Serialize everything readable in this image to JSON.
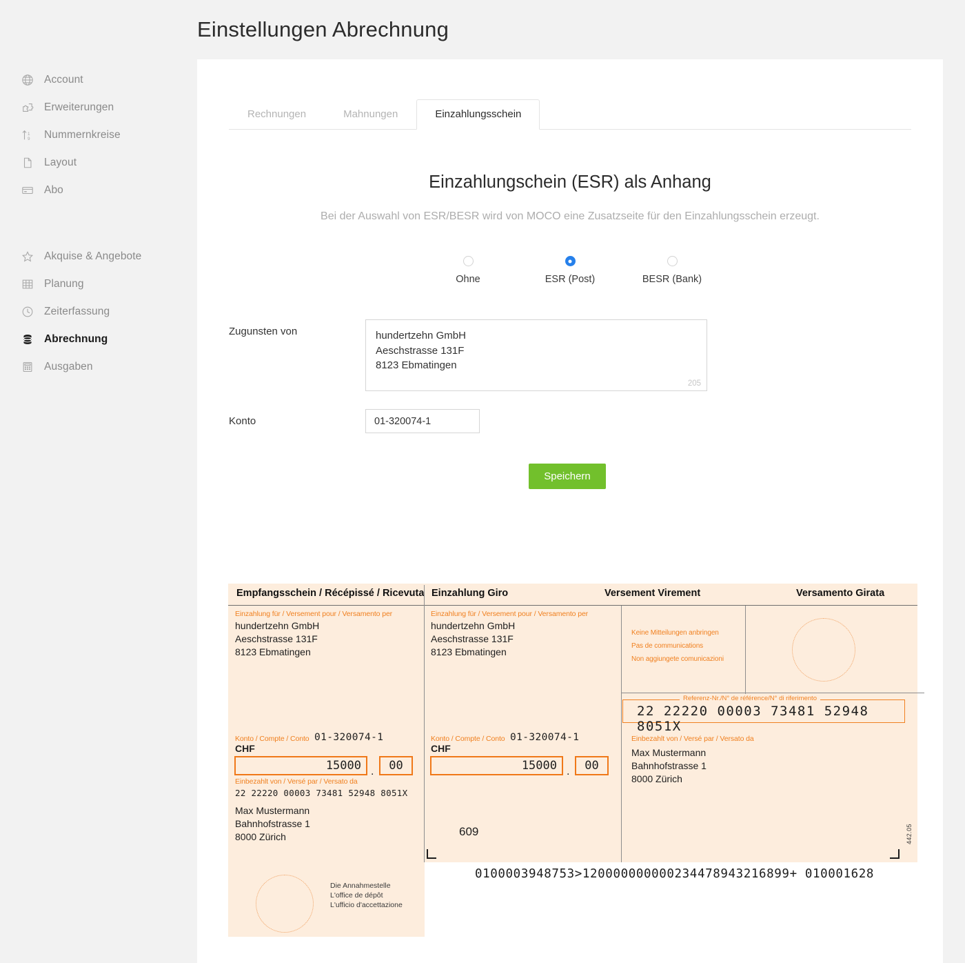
{
  "header": {
    "title": "Einstellungen Abrechnung"
  },
  "sidebar": {
    "group1": [
      {
        "label": "Account",
        "icon": "globe-icon"
      },
      {
        "label": "Erweiterungen",
        "icon": "puzzle-icon"
      },
      {
        "label": "Nummernkreise",
        "icon": "number-range-icon"
      },
      {
        "label": "Layout",
        "icon": "document-icon"
      },
      {
        "label": "Abo",
        "icon": "credit-card-icon"
      }
    ],
    "group2": [
      {
        "label": "Akquise & Angebote",
        "icon": "star-icon",
        "active": false
      },
      {
        "label": "Planung",
        "icon": "grid-icon",
        "active": false
      },
      {
        "label": "Zeiterfassung",
        "icon": "clock-icon",
        "active": false
      },
      {
        "label": "Abrechnung",
        "icon": "database-icon",
        "active": true
      },
      {
        "label": "Ausgaben",
        "icon": "calculator-icon",
        "active": false
      }
    ]
  },
  "tabs": [
    {
      "label": "Rechnungen",
      "active": false
    },
    {
      "label": "Mahnungen",
      "active": false
    },
    {
      "label": "Einzahlungsschein",
      "active": true
    }
  ],
  "main": {
    "heading": "Einzahlungschein (ESR) als Anhang",
    "subtitle": "Bei der Auswahl von ESR/BESR wird von MOCO eine Zusatzseite für den Einzahlungsschein erzeugt.",
    "radios": [
      {
        "label": "Ohne",
        "checked": false
      },
      {
        "label": "ESR (Post)",
        "checked": true
      },
      {
        "label": "BESR (Bank)",
        "checked": false
      }
    ],
    "fields": {
      "zugunsten_label": "Zugunsten von",
      "zugunsten_line1": "hundertzehn GmbH",
      "zugunsten_line2": "Aeschstrasse 131F",
      "zugunsten_line3": "8123 Ebmatingen",
      "char_count": "205",
      "konto_label": "Konto",
      "konto_value": "01-320074-1"
    },
    "save_label": "Speichern"
  },
  "esr": {
    "titles": {
      "receipt": "Empfangsschein / Récépissé / Ricevuta",
      "giro": "Einzahlung Giro",
      "versement": "Versement Virement",
      "versamento": "Versamento Girata"
    },
    "labels": {
      "payment_for": "Einzahlung für / Versement pour / Versamento per",
      "konto": "Konto / Compte / Conto",
      "paid_by": "Einbezahlt von / Versé par / Versato da",
      "reference": "Referenz-Nr./N° de référence/N° di riferimento",
      "no_messages_de": "Keine Mitteilungen anbringen",
      "no_messages_fr": "Pas de communications",
      "no_messages_it": "Non aggiungete comunicazioni",
      "office_de": "Die Annahmestelle",
      "office_fr": "L'office de dépôt",
      "office_it": "L'ufficio d'accettazione"
    },
    "beneficiary": {
      "line1": "hundertzehn GmbH",
      "line2": "Aeschstrasse 131F",
      "line3": "8123 Ebmatingen"
    },
    "payer": {
      "line1": "Max Mustermann",
      "line2": "Bahnhofstrasse 1",
      "line3": "8000 Zürich"
    },
    "account": "01-320074-1",
    "currency": "CHF",
    "amount_major": "15000",
    "amount_decimal_sep": ".",
    "amount_minor": "00",
    "reference_number": "22 22220 00003 73481 52948 8051X",
    "reference_number_plain": "22 22220 00003 73481 52948 8051X",
    "form_number": "609",
    "form_code": "442.05",
    "ocr_line": "0100003948753>120000000000234478943216899+ 010001628"
  },
  "colors": {
    "accent_blue": "#2680eb",
    "save_green": "#72c02c",
    "esr_bg": "#fdeddd",
    "esr_orange": "#f08020",
    "page_bg": "#f2f2f2"
  }
}
